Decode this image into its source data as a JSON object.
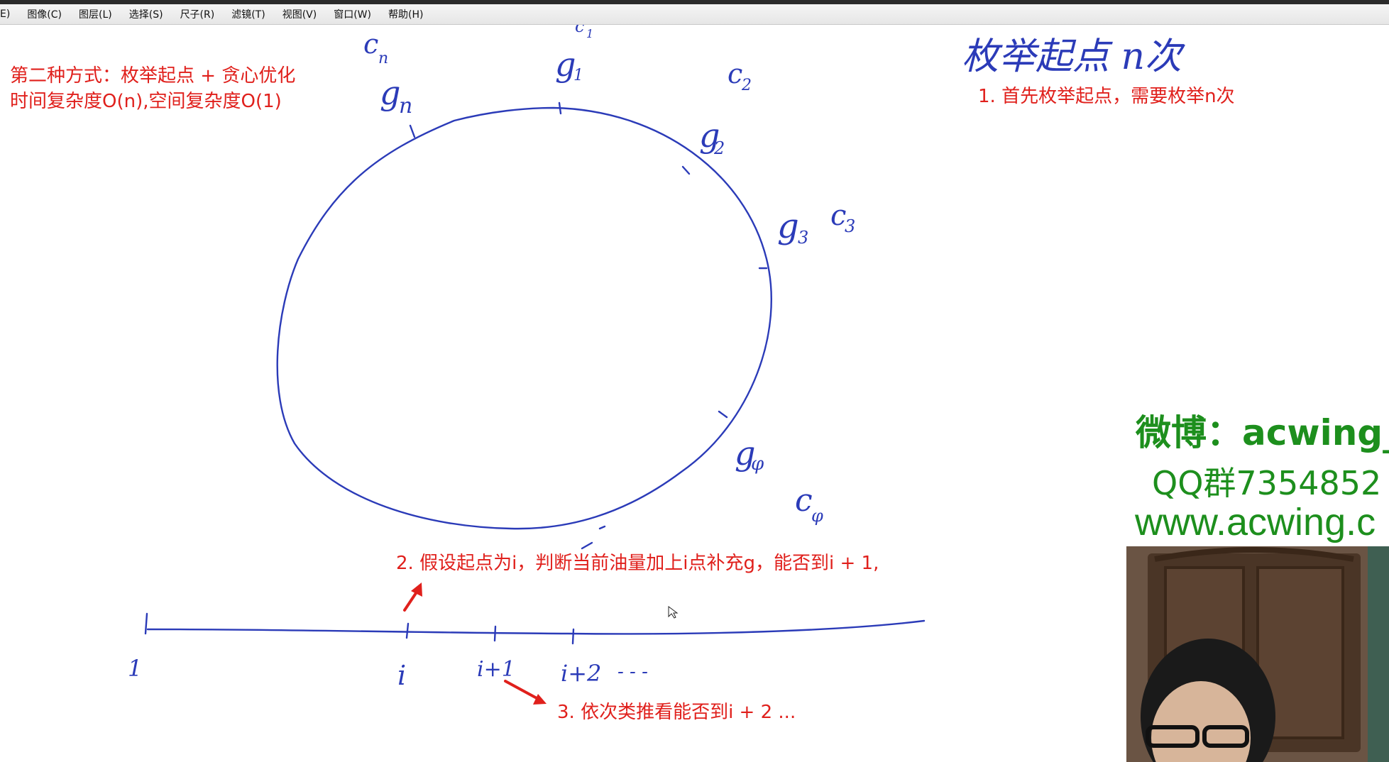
{
  "menu": {
    "items": [
      "E)",
      "图像(C)",
      "图层(L)",
      "选择(S)",
      "尺子(R)",
      "滤镜(T)",
      "视图(V)",
      "窗口(W)",
      "帮助(H)"
    ]
  },
  "notes": {
    "method_line1": "第二种方式：枚举起点 + 贪心优化",
    "method_line2": "时间复杂度O(n),空间复杂度O(1)",
    "step1": "1. 首先枚举起点，需要枚举n次",
    "step2": "2. 假设起点为i，判断当前油量加上i点补充g，能否到i + 1,",
    "step3": "3. 依次类推看能否到i + 2 ..."
  },
  "handwriting": {
    "top_right": "枚举起点  n次",
    "cycle_labels": {
      "cn": "c",
      "cn_sub": "n",
      "gn": "g",
      "gn_sub": "n",
      "g1": "g",
      "g1_sub": "1",
      "c1": "c",
      "c1_sub": "1",
      "c2": "c",
      "c2_sub": "2",
      "g2": "g",
      "g2_sub": "2",
      "g3": "g",
      "g3_sub": "3",
      "c3": "c",
      "c3_sub": "3",
      "g4": "g",
      "g4_sub": "φ",
      "c4": "c",
      "c4_sub": "φ"
    },
    "line_labels": {
      "one": "1",
      "i": "i",
      "i1": "i+1",
      "i2": "i+2",
      "dots": "- - -"
    }
  },
  "watermark": {
    "weibo": "微博：acwing_",
    "qq": "QQ群7354852",
    "site": "www.acwing.c"
  },
  "colors": {
    "ink": "#2b3bb8",
    "note": "#e0201c",
    "watermark": "#1d8f1d"
  }
}
